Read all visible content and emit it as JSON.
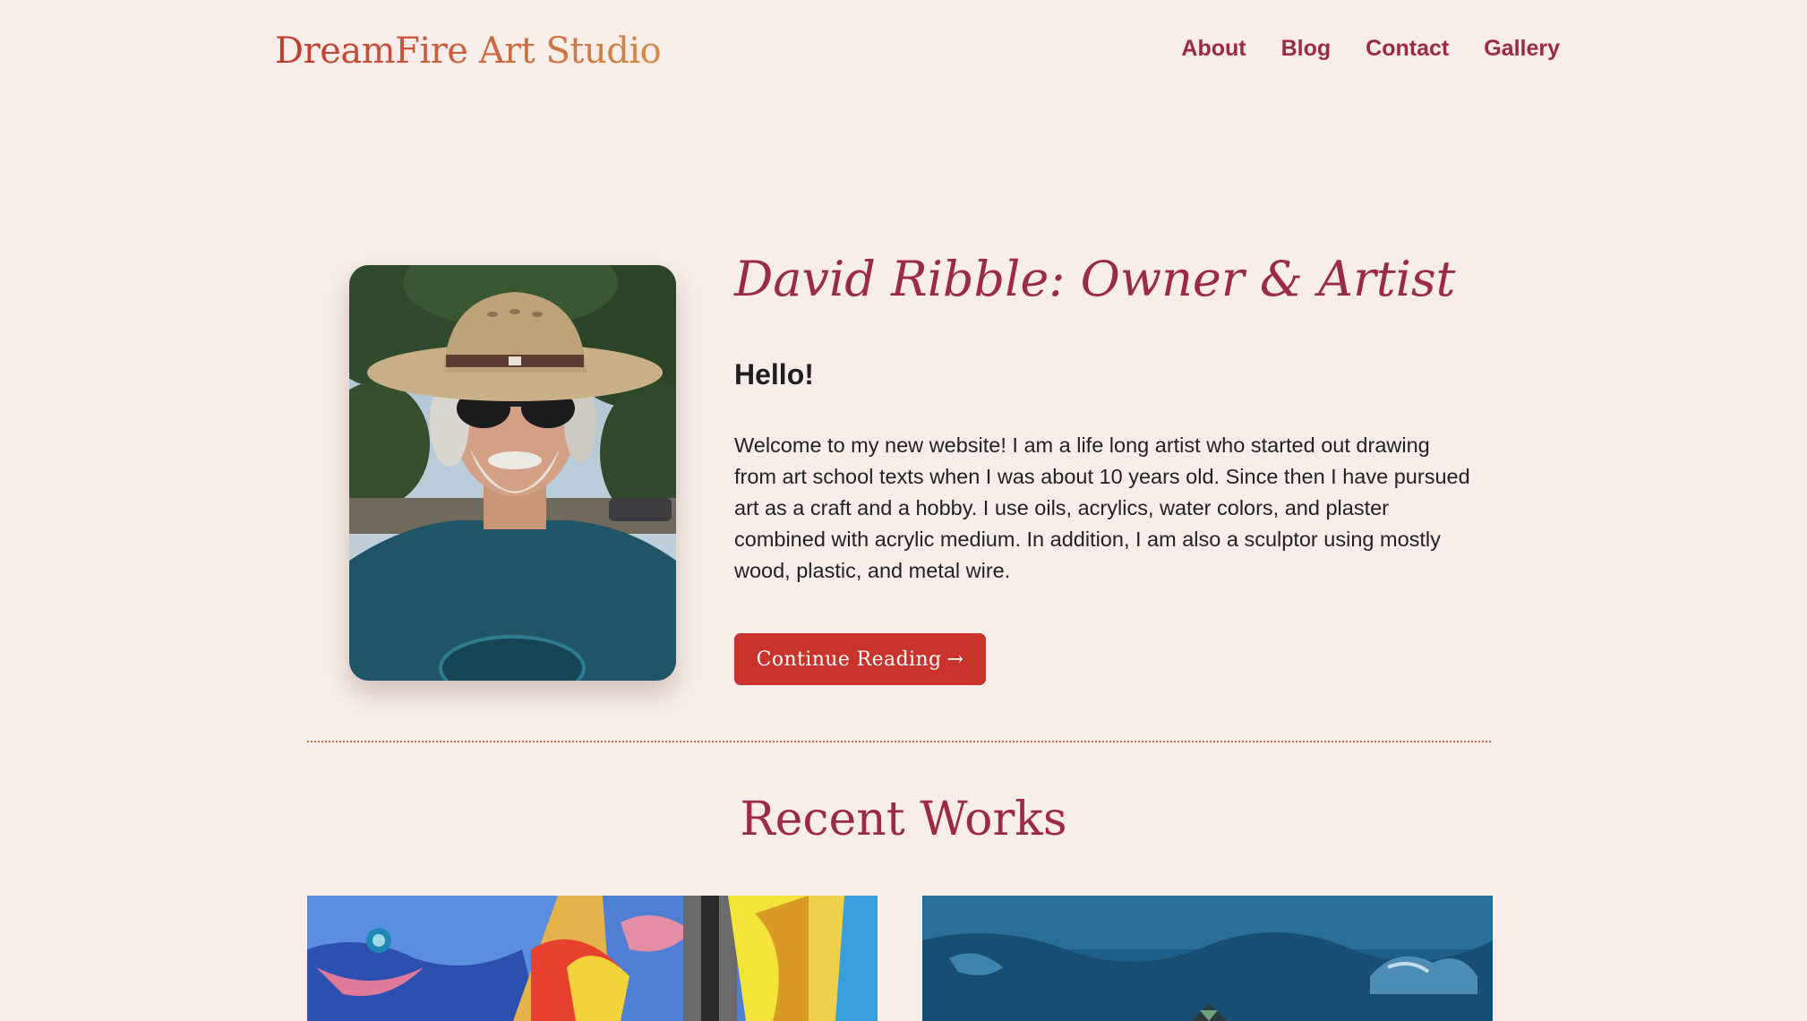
{
  "header": {
    "site_title": "DreamFire Art Studio",
    "nav": [
      {
        "label": "About"
      },
      {
        "label": "Blog"
      },
      {
        "label": "Contact"
      },
      {
        "label": "Gallery"
      }
    ]
  },
  "about": {
    "title": "David Ribble: Owner & Artist",
    "greeting": "Hello!",
    "intro": "Welcome to my new website! I am a life long artist who started out drawing from art school texts when I was about 10 years old. Since then I have pursued art as a craft and a hobby. I use oils, acrylics, water colors, and plaster combined with acrylic medium. In addition, I am also a sculptor using mostly wood, plastic, and metal wire.",
    "button_label": "Continue Reading",
    "button_icon": "arrow-right-icon",
    "button_arrow": "→"
  },
  "recent_works": {
    "title": "Recent Works"
  },
  "colors": {
    "background": "#f8ede8",
    "accent": "#9b2a43",
    "button": "#c8342c",
    "title_gradient_start": "#c0392b",
    "title_gradient_end": "#d38a45"
  }
}
